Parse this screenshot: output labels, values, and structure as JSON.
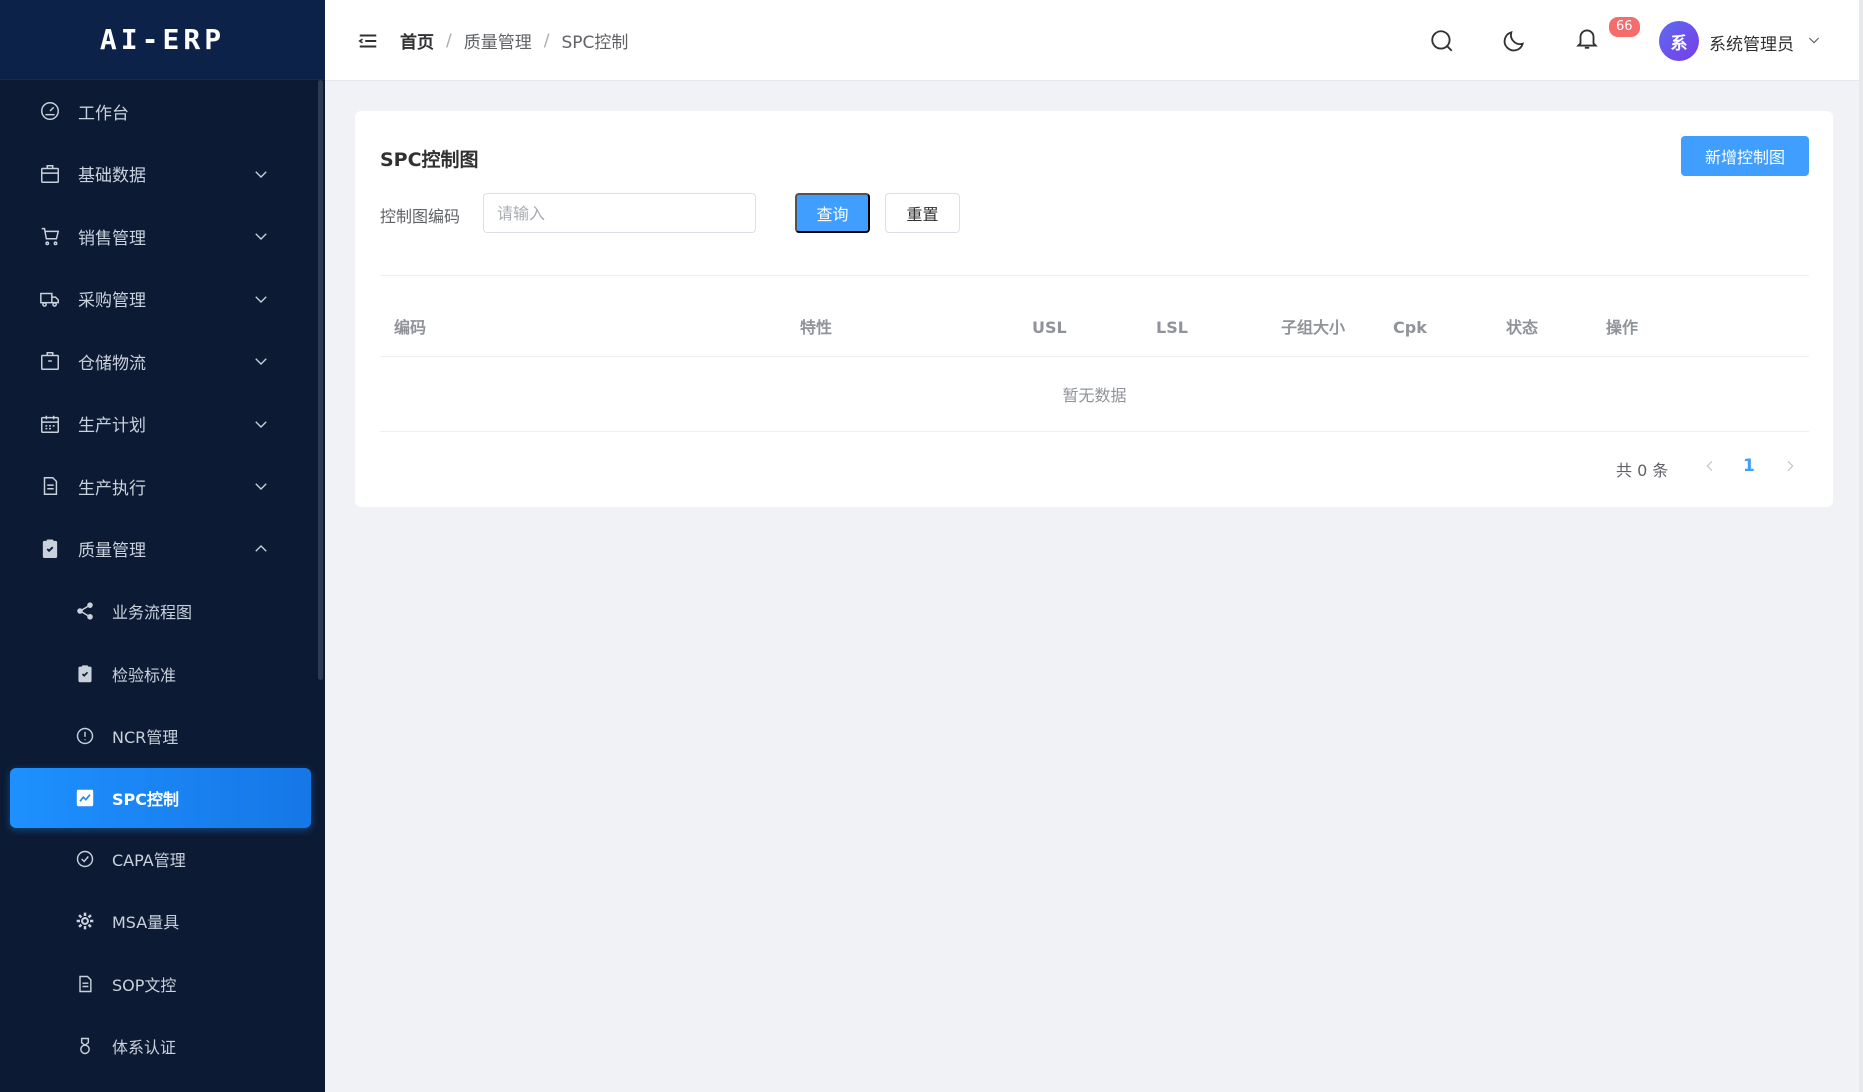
{
  "app": {
    "logo": "AI-ERP"
  },
  "sidebar": {
    "items": [
      {
        "label": "工作台",
        "icon": "dashboard-icon"
      },
      {
        "label": "基础数据",
        "icon": "package-icon",
        "expanded": false
      },
      {
        "label": "销售管理",
        "icon": "cart-icon",
        "expanded": false
      },
      {
        "label": "采购管理",
        "icon": "truck-icon",
        "expanded": false
      },
      {
        "label": "仓储物流",
        "icon": "warehouse-icon",
        "expanded": false
      },
      {
        "label": "生产计划",
        "icon": "calendar-icon",
        "expanded": false
      },
      {
        "label": "生产执行",
        "icon": "document-icon",
        "expanded": false
      },
      {
        "label": "质量管理",
        "icon": "clipboard-check-icon",
        "expanded": true
      }
    ],
    "quality_sub": [
      {
        "label": "业务流程图",
        "icon": "share-icon"
      },
      {
        "label": "检验标准",
        "icon": "clipboard-check-icon"
      },
      {
        "label": "NCR管理",
        "icon": "alert-circle-icon"
      },
      {
        "label": "SPC控制",
        "icon": "chart-icon",
        "active": true
      },
      {
        "label": "CAPA管理",
        "icon": "check-circle-icon"
      },
      {
        "label": "MSA量具",
        "icon": "gear-icon"
      },
      {
        "label": "SOP文控",
        "icon": "document-icon"
      },
      {
        "label": "体系认证",
        "icon": "medal-icon"
      }
    ]
  },
  "header": {
    "breadcrumb": [
      "首页",
      "质量管理",
      "SPC控制"
    ],
    "notification_count": "66",
    "user": {
      "avatar_text": "系",
      "name": "系统管理员"
    }
  },
  "card": {
    "title": "SPC控制图",
    "add_button": "新增控制图",
    "filter": {
      "label": "控制图编码",
      "placeholder": "请输入",
      "value": ""
    },
    "query_button": "查询",
    "reset_button": "重置",
    "table": {
      "columns": [
        "编码",
        "特性",
        "USL",
        "LSL",
        "子组大小",
        "Cpk",
        "状态",
        "操作"
      ],
      "rows": [],
      "empty_text": "暂无数据"
    },
    "pagination": {
      "total_text": "共 0 条",
      "current_page": "1"
    }
  },
  "colors": {
    "primary": "#409eff",
    "sidebar_bg": "#0c1a33",
    "active_item": "#1e90ff",
    "badge": "#f56c6c"
  }
}
